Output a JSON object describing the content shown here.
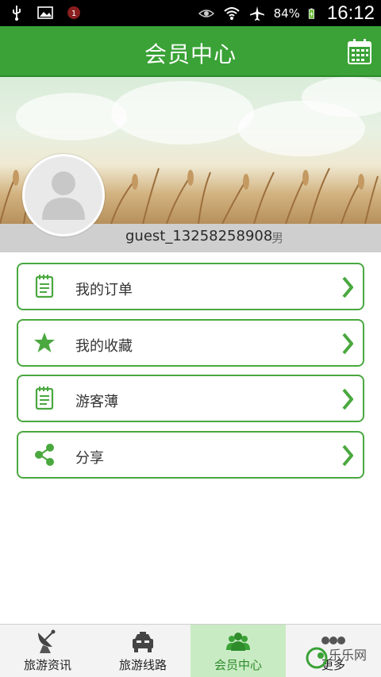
{
  "status_bar": {
    "battery": "84%",
    "time": "16:12"
  },
  "header": {
    "title": "会员中心"
  },
  "profile": {
    "username": "guest_13258258908",
    "gender": "男"
  },
  "menu": {
    "items": [
      {
        "label": "我的订单",
        "icon": "notepad-icon"
      },
      {
        "label": "我的收藏",
        "icon": "star-icon"
      },
      {
        "label": "游客薄",
        "icon": "notepad-icon"
      },
      {
        "label": "分享",
        "icon": "share-icon"
      }
    ]
  },
  "tabs": [
    {
      "label": "旅游资讯",
      "icon": "satellite-dish-icon"
    },
    {
      "label": "旅游线路",
      "icon": "car-icon"
    },
    {
      "label": "会员中心",
      "icon": "users-icon",
      "active": true
    },
    {
      "label": "更多",
      "icon": "more-icon"
    }
  ],
  "watermark": {
    "text": "乐乐网"
  },
  "colors": {
    "brand_green": "#3aa236",
    "border_green": "#4aa83f",
    "active_tab": "#c9ebc4"
  }
}
